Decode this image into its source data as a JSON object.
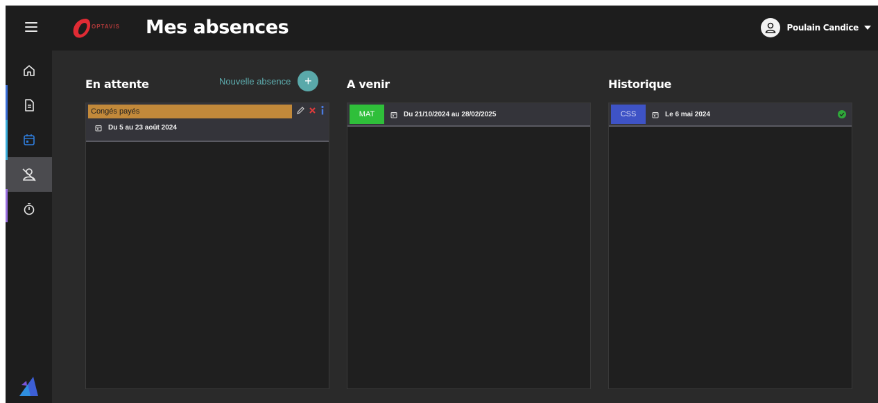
{
  "app": {
    "logo_text": "OPTAVIS",
    "title": "Mes absences"
  },
  "user": {
    "name": "Poulain Candice"
  },
  "sidebar": {
    "items": [
      {
        "icon": "home-icon"
      },
      {
        "icon": "document-icon"
      },
      {
        "icon": "calendar-icon"
      },
      {
        "icon": "user-off-icon"
      },
      {
        "icon": "stopwatch-icon"
      }
    ],
    "active_index": 3
  },
  "pending": {
    "title": "En attente",
    "new_label": "Nouvelle absence",
    "new_icon": "+",
    "cards": [
      {
        "type": "Congés payés",
        "date": "Du 5 au 23 août 2024",
        "color": "#c2893a"
      }
    ]
  },
  "upcoming": {
    "title": "A venir",
    "cards": [
      {
        "code": "MAT",
        "date": "Du 21/10/2024 au 28/02/2025",
        "color": "#2fbf3a"
      }
    ]
  },
  "history": {
    "title": "Historique",
    "cards": [
      {
        "code": "CSS",
        "date": "Le 6 mai 2024",
        "color": "#3e53c6",
        "status": "validated"
      }
    ]
  },
  "colors": {
    "background": "#2a2a2a",
    "topbar": "#1d1d1d",
    "accent": "#5aa9aa",
    "delete": "#e23b3b",
    "info": "#4a7be0",
    "success": "#2fa83a"
  }
}
